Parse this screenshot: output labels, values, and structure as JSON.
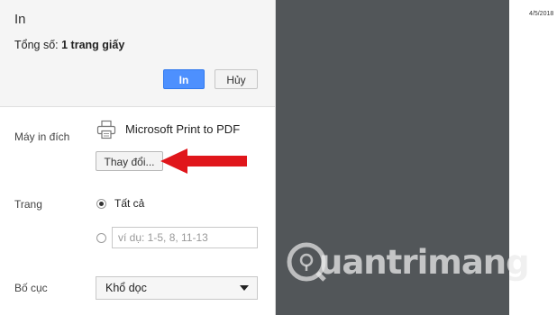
{
  "header": {
    "title": "In",
    "total_prefix": "Tổng số:",
    "total_value": "1 trang giấy",
    "print_label": "In",
    "cancel_label": "Hủy"
  },
  "destination": {
    "label": "Máy in đích",
    "printer_name": "Microsoft Print to PDF",
    "printer_icon": "printer-icon",
    "change_label": "Thay đổi..."
  },
  "pages": {
    "label": "Trang",
    "all_label": "Tất cả",
    "all_selected": true,
    "custom_placeholder": "ví dụ: 1-5, 8, 11-13"
  },
  "layout": {
    "label": "Bố cục",
    "selected": "Khổ dọc"
  },
  "preview": {
    "date": "4/5/2018",
    "watermark": "uantrimang"
  },
  "colors": {
    "accent": "#4d90fe",
    "arrow": "#e0161b",
    "preview_bg": "#525659"
  }
}
